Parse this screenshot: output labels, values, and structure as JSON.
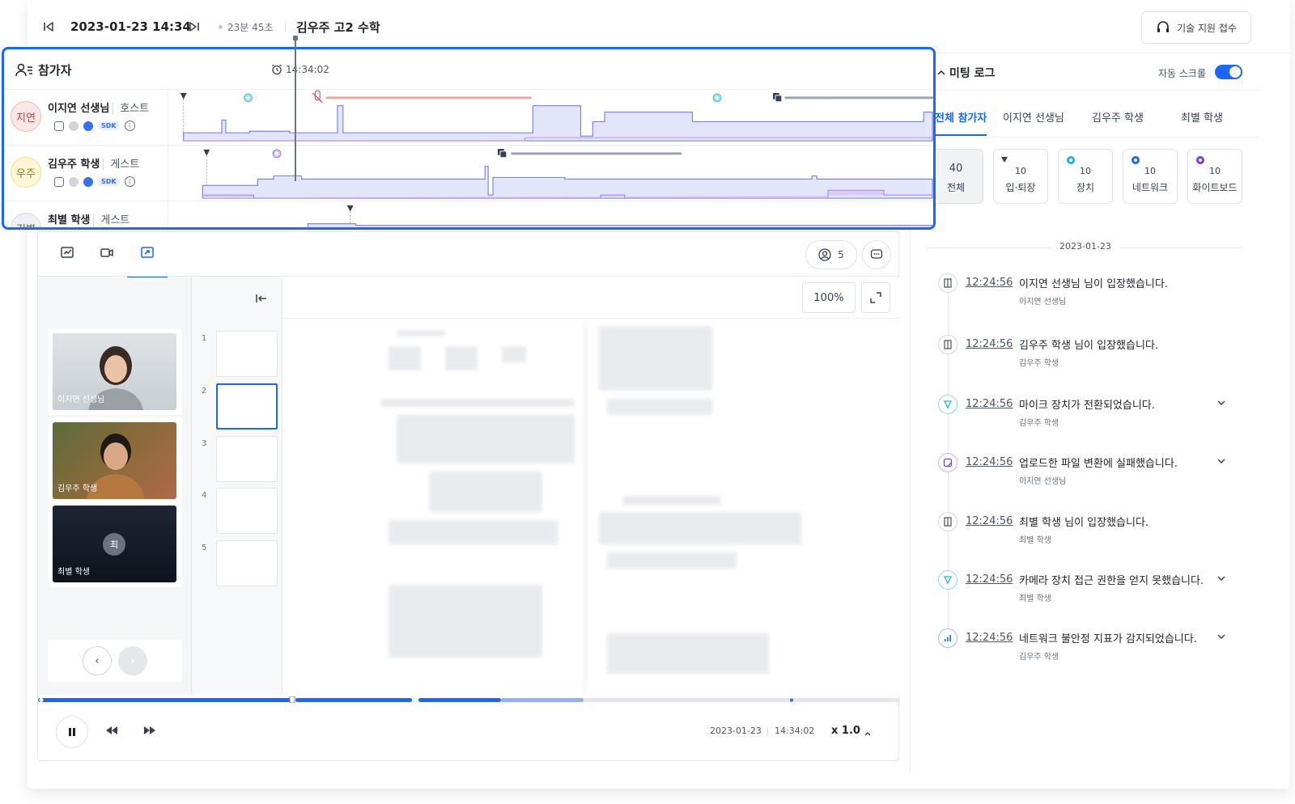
{
  "topbar": {
    "datetime": "2023-01-23 14:34",
    "duration": "23분 45초",
    "title": "김우주 고2 수학",
    "support_label": "기술 지원 접수"
  },
  "timeline": {
    "title": "참가자",
    "current_time": "14:34:02",
    "participants": [
      {
        "avatar": "지연",
        "name": "이지연 선생님",
        "role": "호스트"
      },
      {
        "avatar": "우주",
        "name": "김우주 학생",
        "role": "게스트"
      },
      {
        "avatar": "김별",
        "name": "최별 학생",
        "role": "게스트"
      }
    ],
    "sdk_label": "SDK"
  },
  "player": {
    "participants_count": "5",
    "zoom": "100%",
    "videos": [
      {
        "label": "이지연 선생님"
      },
      {
        "label": "김우주 학생"
      },
      {
        "label": "최별 학생",
        "initial": "최"
      }
    ],
    "thumbs": [
      "1",
      "2",
      "3",
      "4",
      "5"
    ],
    "playback_date": "2023-01-23",
    "playback_time": "14:34:02",
    "speed": "x 1.0",
    "progress": 0.32
  },
  "log": {
    "title": "미팅 로그",
    "auto_scroll_label": "자동 스크롤",
    "tabs": [
      "전체 참가자",
      "이지연 선생님",
      "김우주 학생",
      "최별 학생"
    ],
    "filters": [
      {
        "count": "40",
        "label": "전체",
        "color": ""
      },
      {
        "count": "10",
        "label": "입·퇴장",
        "color": "#374151"
      },
      {
        "count": "10",
        "label": "장치",
        "color": "#1fb6e0"
      },
      {
        "count": "10",
        "label": "네트워크",
        "color": "#1a66ff"
      },
      {
        "count": "10",
        "label": "화이트보드",
        "color": "#7c3aed"
      }
    ],
    "date": "2023-01-23",
    "entries": [
      {
        "icon": "door-icon",
        "time": "12:24:56",
        "message": "이지연 선생님 님이 입장했습니다.",
        "who": "이지연 선생님",
        "expandable": false
      },
      {
        "icon": "door-icon",
        "time": "12:24:56",
        "message": "김우주 학생 님이 입장했습니다.",
        "who": "김우주 학생",
        "expandable": false
      },
      {
        "icon": "device-icon",
        "time": "12:24:56",
        "message": "마이크 장치가 전환되었습니다.",
        "who": "김우주 학생",
        "expandable": true
      },
      {
        "icon": "whiteboard-icon",
        "time": "12:24:56",
        "message": "업로드한 파일 변환에 실패했습니다.",
        "who": "이지연 선생님",
        "expandable": true
      },
      {
        "icon": "door-icon",
        "time": "12:24:56",
        "message": "최별 학생 님이 입장했습니다.",
        "who": "최별 학생",
        "expandable": false
      },
      {
        "icon": "device-icon",
        "time": "12:24:56",
        "message": "카메라 장치 접근 권한을 얻지 못했습니다.",
        "who": "최별 학생",
        "expandable": true
      },
      {
        "icon": "network-icon",
        "time": "12:24:56",
        "message": "네트워크 불안정 지표가 감지되었습니다.",
        "who": "김우주 학생",
        "expandable": true
      }
    ]
  },
  "colors": {
    "accent": "#1a66ff",
    "highlight_border": "#1a66ff",
    "graph_fill": "#e3e6fb",
    "graph_line": "#7b86e8"
  }
}
